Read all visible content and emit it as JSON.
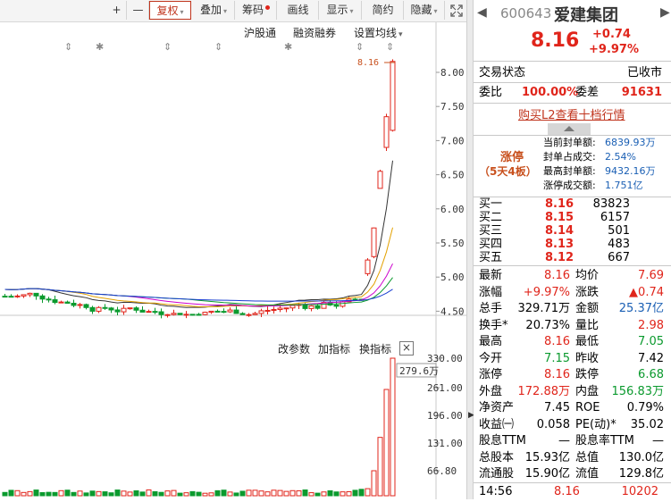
{
  "toolbar": {
    "plus": "+",
    "minus": "—",
    "fuquan": "复权",
    "diejia": "叠加",
    "chouma": "筹码",
    "huaxian": "画线",
    "xianshi": "显示",
    "jianyue": "简约",
    "yincang": "隐藏"
  },
  "chart_links": {
    "hugutong": "沪股通",
    "rongzi": "融资融券",
    "shezhi": "设置均线"
  },
  "price_axis": [
    "8.00",
    "7.50",
    "7.00",
    "6.50",
    "6.00",
    "5.50",
    "5.00",
    "4.50"
  ],
  "price_marker": "8.16",
  "volume_axis": [
    "330.00",
    "261.00",
    "196.00",
    "131.00",
    "66.80"
  ],
  "volume_marker": "279.6万",
  "volume_links": {
    "gaicanshu": "改参数",
    "jiazhibiao": "加指标",
    "huanzhibiao": "换指标",
    "close": "×"
  },
  "header": {
    "code": "600643",
    "name": "爱建集团",
    "price": "8.16",
    "change": "+0.74",
    "pct": "+9.97%"
  },
  "status": {
    "label": "交易状态",
    "value": "已收市"
  },
  "weibi": {
    "label1": "委比",
    "value1": "100.00%",
    "label2": "委差",
    "value2": "91631"
  },
  "l2_link": "购买L2查看十档行情",
  "zhangting": {
    "title": "涨停",
    "sub": "（5天4板）",
    "rows": [
      {
        "label": "当前封单额:",
        "value": "6839.93万"
      },
      {
        "label": "封单占成交:",
        "value": "2.54%"
      },
      {
        "label": "最高封单额:",
        "value": "9432.16万"
      },
      {
        "label": "涨停成交额:",
        "value": "1.751亿"
      }
    ]
  },
  "bids": [
    {
      "label": "买一",
      "price": "8.16",
      "vol": "83823"
    },
    {
      "label": "买二",
      "price": "8.15",
      "vol": "6157"
    },
    {
      "label": "买三",
      "price": "8.14",
      "vol": "501"
    },
    {
      "label": "买四",
      "price": "8.13",
      "vol": "483"
    },
    {
      "label": "买五",
      "price": "8.12",
      "vol": "667"
    }
  ],
  "stats": [
    {
      "l1": "最新",
      "v1": "8.16",
      "c1": "red",
      "l2": "均价",
      "v2": "7.69",
      "c2": "red"
    },
    {
      "l1": "涨幅",
      "v1": "+9.97%",
      "c1": "red",
      "l2": "涨跌",
      "v2": "▲0.74",
      "c2": "red"
    },
    {
      "l1": "总手",
      "v1": "329.71万",
      "c1": "black",
      "l2": "金额",
      "v2": "25.37亿",
      "c2": "blue"
    },
    {
      "l1": "换手*",
      "v1": "20.73%",
      "c1": "black",
      "l2": "量比",
      "v2": "2.98",
      "c2": "red"
    },
    {
      "l1": "最高",
      "v1": "8.16",
      "c1": "red",
      "l2": "最低",
      "v2": "7.05",
      "c2": "green"
    },
    {
      "l1": "今开",
      "v1": "7.15",
      "c1": "green",
      "l2": "昨收",
      "v2": "7.42",
      "c2": "black"
    },
    {
      "l1": "涨停",
      "v1": "8.16",
      "c1": "red",
      "l2": "跌停",
      "v2": "6.68",
      "c2": "green"
    },
    {
      "l1": "外盘",
      "v1": "172.88万",
      "c1": "red",
      "l2": "内盘",
      "v2": "156.83万",
      "c2": "green"
    },
    {
      "l1": "净资产",
      "v1": "7.45",
      "c1": "black",
      "l2": "ROE",
      "v2": "0.79%",
      "c2": "black"
    },
    {
      "l1": "收益㈠",
      "v1": "0.058",
      "c1": "black",
      "l2": "PE(动)*",
      "v2": "35.02",
      "c2": "black"
    },
    {
      "l1": "股息TTM",
      "v1": "—",
      "c1": "black",
      "l2": "股息率TTM",
      "v2": "—",
      "c2": "black"
    },
    {
      "l1": "总股本",
      "v1": "15.93亿",
      "c1": "black",
      "l2": "总值",
      "v2": "130.0亿",
      "c2": "black"
    },
    {
      "l1": "流通股",
      "v1": "15.90亿",
      "c1": "black",
      "l2": "流值",
      "v2": "129.8亿",
      "c2": "black"
    }
  ],
  "tick": {
    "time": "14:56",
    "price": "8.16",
    "vol": "10202"
  }
}
